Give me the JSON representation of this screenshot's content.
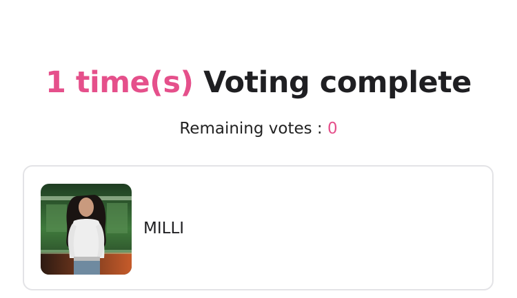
{
  "headline": {
    "count": "1 time(s)",
    "text": "Voting complete"
  },
  "remaining": {
    "label": "Remaining votes : ",
    "value": "0"
  },
  "candidate": {
    "name": "MILLI"
  },
  "colors": {
    "accent": "#e5508b",
    "card_border": "#e3e3e6"
  }
}
